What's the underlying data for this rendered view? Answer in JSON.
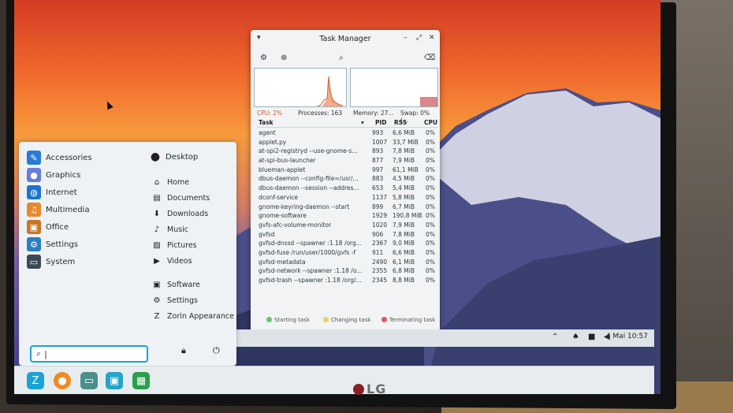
{
  "colors": {
    "accent": "#1aa3d6",
    "cpu": "#d35a24",
    "menu_bg": "#eef2f4",
    "taskbar_bg": "#e7ecef"
  },
  "taskmanager": {
    "title": "Task Manager",
    "stats": {
      "cpu": "CPU: 2%",
      "processes": "Processes: 163",
      "memory": "Memory: 27...",
      "swap": "Swap: 0% (..."
    },
    "columns": {
      "task": "Task",
      "pid": "PID",
      "rss": "RSS",
      "cpu": "CPU"
    },
    "rows": [
      {
        "task": "agent",
        "pid": "993",
        "rss": "6,6 MiB",
        "cpu": "0%"
      },
      {
        "task": "applet.py",
        "pid": "1007",
        "rss": "33,7 MiB",
        "cpu": "0%"
      },
      {
        "task": "at-spi2-registryd --use-gnome-s...",
        "pid": "893",
        "rss": "7,8 MiB",
        "cpu": "0%"
      },
      {
        "task": "at-spi-bus-launcher",
        "pid": "877",
        "rss": "7,9 MiB",
        "cpu": "0%"
      },
      {
        "task": "blueman-applet",
        "pid": "997",
        "rss": "61,1 MiB",
        "cpu": "0%"
      },
      {
        "task": "dbus-daemon --config-file=/usr/...",
        "pid": "883",
        "rss": "4,5 MiB",
        "cpu": "0%"
      },
      {
        "task": "dbus-daemon --session --addres...",
        "pid": "653",
        "rss": "5,4 MiB",
        "cpu": "0%"
      },
      {
        "task": "dconf-service",
        "pid": "1137",
        "rss": "5,8 MiB",
        "cpu": "0%"
      },
      {
        "task": "gnome-keyring-daemon --start",
        "pid": "899",
        "rss": "6,7 MiB",
        "cpu": "0%"
      },
      {
        "task": "gnome-software",
        "pid": "1929",
        "rss": "190,8 MiB",
        "cpu": "0%"
      },
      {
        "task": "gvfs-afc-volume-monitor",
        "pid": "1020",
        "rss": "7,9 MiB",
        "cpu": "0%"
      },
      {
        "task": "gvfsd",
        "pid": "906",
        "rss": "7,8 MiB",
        "cpu": "0%"
      },
      {
        "task": "gvfsd-dnssd --spawner :1.18 /org...",
        "pid": "2367",
        "rss": "9,0 MiB",
        "cpu": "0%"
      },
      {
        "task": "gvfsd-fuse /run/user/1000/gvfs -f",
        "pid": "911",
        "rss": "6,6 MiB",
        "cpu": "0%"
      },
      {
        "task": "gvfsd-metadata",
        "pid": "2490",
        "rss": "6,1 MiB",
        "cpu": "0%"
      },
      {
        "task": "gvfsd-network --spawner :1.18 /o...",
        "pid": "2355",
        "rss": "6,8 MiB",
        "cpu": "0%"
      },
      {
        "task": "gvfsd-trash --spawner :1.18 /org/...",
        "pid": "2345",
        "rss": "8,8 MiB",
        "cpu": "0%"
      }
    ],
    "legend": {
      "starting": "Starting task",
      "changing": "Changing task",
      "terminating": "Terminating task"
    }
  },
  "menu": {
    "categories": [
      {
        "label": "Accessories",
        "icon": "accessories-icon"
      },
      {
        "label": "Graphics",
        "icon": "graphics-icon"
      },
      {
        "label": "Internet",
        "icon": "internet-icon"
      },
      {
        "label": "Multimedia",
        "icon": "multimedia-icon"
      },
      {
        "label": "Office",
        "icon": "office-icon"
      },
      {
        "label": "Settings",
        "icon": "settings-icon"
      },
      {
        "label": "System",
        "icon": "system-icon"
      }
    ],
    "user": "Desktop",
    "places": [
      "Home",
      "Documents",
      "Downloads",
      "Music",
      "Pictures",
      "Videos"
    ],
    "actions": [
      "Software",
      "Settings",
      "Zorin Appearance"
    ]
  },
  "tray": {
    "clock": "4 Mai 10:57"
  },
  "monitor": {
    "brand": "LG"
  }
}
